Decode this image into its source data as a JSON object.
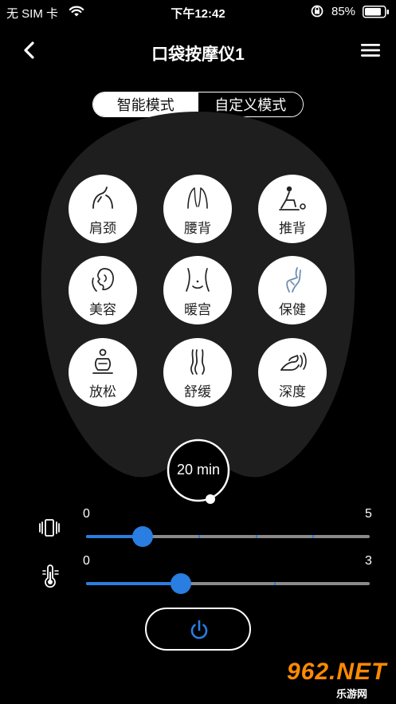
{
  "status_bar": {
    "carrier": "无 SIM 卡",
    "time": "下午12:42",
    "battery_percent": "85%",
    "battery_level": 0.85
  },
  "nav": {
    "title": "口袋按摩仪1",
    "back_icon": "chevron-left-icon",
    "menu_icon": "hamburger-menu-icon"
  },
  "mode_tabs": {
    "options": [
      "智能模式",
      "自定义模式"
    ],
    "selected": "智能模式"
  },
  "modes": [
    {
      "label": "肩颈",
      "icon": "shoulder-neck-icon"
    },
    {
      "label": "腰背",
      "icon": "waist-back-icon"
    },
    {
      "label": "推背",
      "icon": "push-back-icon"
    },
    {
      "label": "美容",
      "icon": "beauty-face-icon"
    },
    {
      "label": "暖宫",
      "icon": "warm-womb-icon"
    },
    {
      "label": "保健",
      "icon": "health-care-icon"
    },
    {
      "label": "放松",
      "icon": "relax-icon"
    },
    {
      "label": "舒缓",
      "icon": "soothe-icon"
    },
    {
      "label": "深度",
      "icon": "deep-massage-icon"
    }
  ],
  "timer": {
    "label": "20 min",
    "progress": 0.0
  },
  "intensity_slider": {
    "icon": "vibration-icon",
    "min_label": "0",
    "max_label": "5",
    "min": 0,
    "max": 5,
    "value": 1
  },
  "heat_slider": {
    "icon": "thermometer-heat-icon",
    "min_label": "0",
    "max_label": "3",
    "min": 0,
    "max": 3,
    "value": 1
  },
  "power_button": {
    "icon": "power-icon"
  },
  "watermark": {
    "brand": "962.NET",
    "sub": "乐游网"
  },
  "colors": {
    "accent": "#2a7de1",
    "background": "#000000",
    "blob": "#1e1e1e",
    "watermark": "#ff8a00"
  }
}
